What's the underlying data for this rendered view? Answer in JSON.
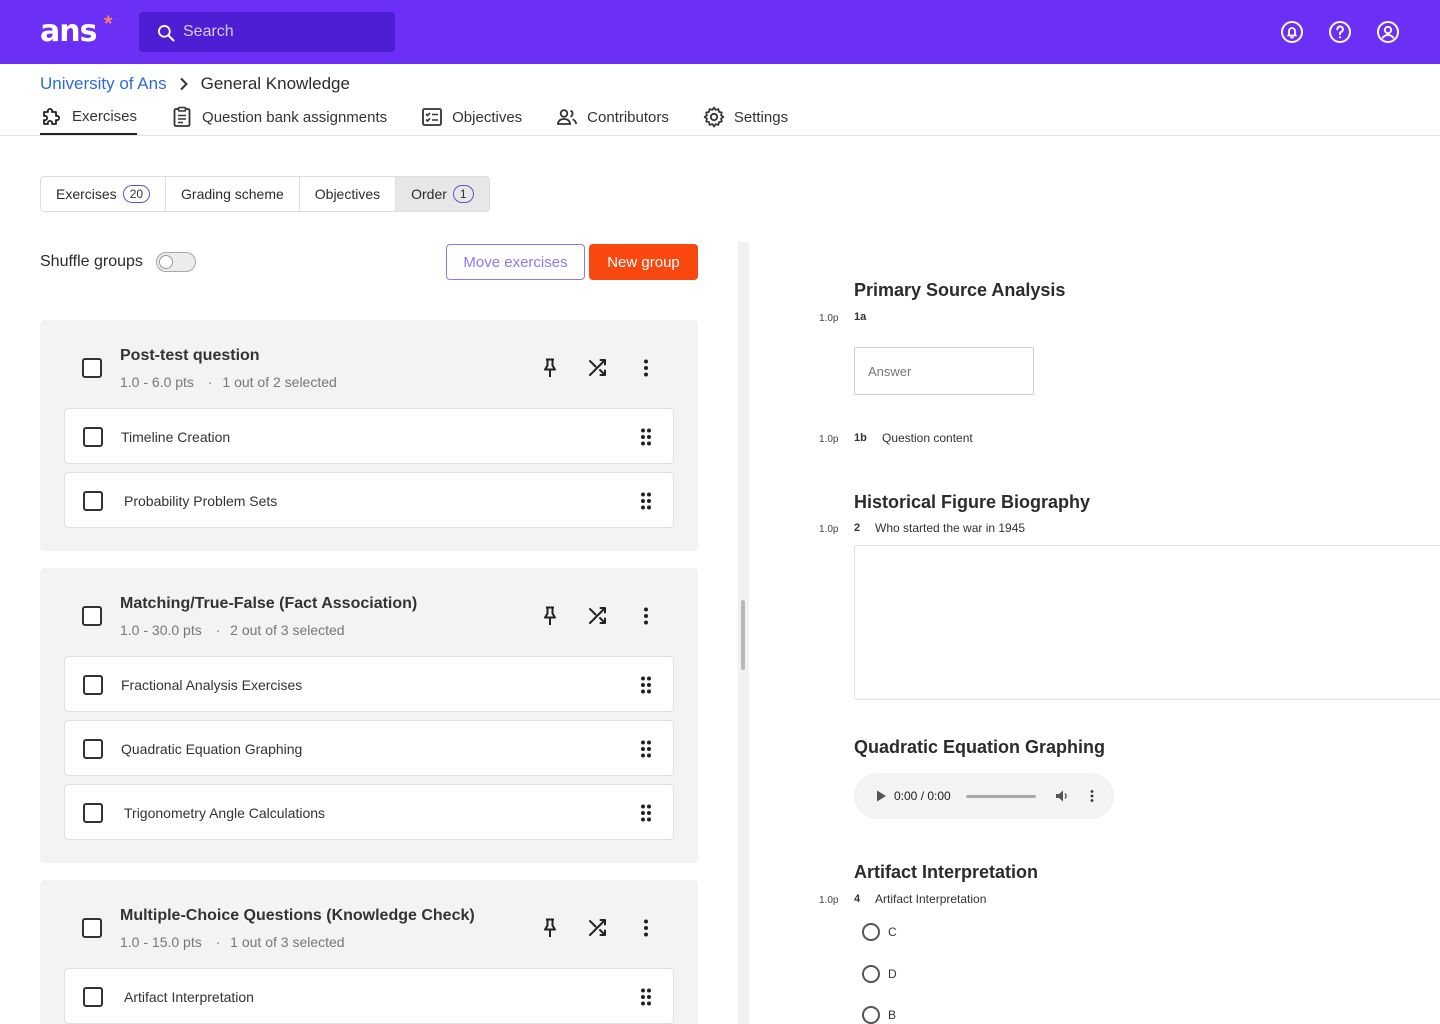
{
  "app": {
    "logo": "ans",
    "logo_mark": "*",
    "search_placeholder": "Search",
    "header_icons": [
      "bell-icon",
      "help-icon",
      "account-icon"
    ],
    "accent_color": "#6b2ff5"
  },
  "breadcrumb": {
    "parent": "University of Ans",
    "current": "General Knowledge"
  },
  "nav_tabs": [
    {
      "label": "Exercises",
      "icon": "puzzle-icon",
      "active": true
    },
    {
      "label": "Question bank assignments",
      "icon": "clipboard-icon"
    },
    {
      "label": "Objectives",
      "icon": "checklist-icon"
    },
    {
      "label": "Contributors",
      "icon": "users-icon"
    },
    {
      "label": "Settings",
      "icon": "gear-icon"
    }
  ],
  "sub_tabs": [
    {
      "label": "Exercises",
      "badge": "20"
    },
    {
      "label": "Grading scheme"
    },
    {
      "label": "Objectives"
    },
    {
      "label": "Order",
      "badge": "1",
      "active": true
    }
  ],
  "toolbar": {
    "shuffle_label": "Shuffle groups",
    "shuffle_on": false,
    "move_label": "Move exercises",
    "new_group_label": "New group",
    "new_group_color": "#f8470f"
  },
  "groups": [
    {
      "title": "Post-test question",
      "points": "1.0 - 6.0 pts",
      "selected": "1 out of 2 selected",
      "items": [
        "Timeline Creation",
        "Probability Problem Sets"
      ]
    },
    {
      "title": "Matching/True-False (Fact Association)",
      "points": "1.0 - 30.0 pts",
      "selected": "2 out of 3 selected",
      "items": [
        "Fractional Analysis Exercises",
        "Quadratic Equation Graphing",
        "Trigonometry Angle Calculations"
      ]
    },
    {
      "title": "Multiple-Choice Questions (Knowledge Check)",
      "points": "1.0 - 15.0 pts",
      "selected": "1 out of 3 selected",
      "items": [
        "Artifact Interpretation"
      ]
    }
  ],
  "meta_separator": "·",
  "preview": {
    "q1": {
      "title": "Primary Source Analysis",
      "a_points": "1.0p",
      "a_num": "1a",
      "answer_placeholder": "Answer",
      "b_points": "1.0p",
      "b_num": "1b",
      "b_text": "Question content"
    },
    "q2": {
      "title": "Historical Figure Biography",
      "points": "1.0p",
      "num": "2",
      "text": "Who started the war in 1945"
    },
    "q3": {
      "title": "Quadratic Equation Graphing",
      "audio_time": "0:00 / 0:00"
    },
    "q4": {
      "title": "Artifact Interpretation",
      "points": "1.0p",
      "num": "4",
      "text": "Artifact Interpretation",
      "options": [
        "C",
        "D",
        "B"
      ]
    }
  }
}
